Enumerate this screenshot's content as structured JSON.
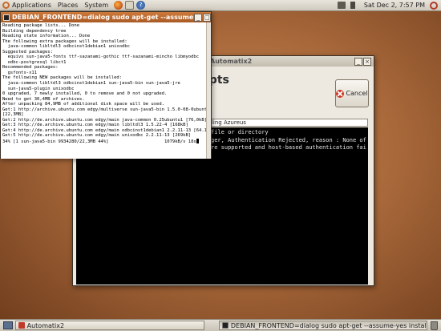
{
  "top_panel": {
    "menus": [
      "Applications",
      "Places",
      "System"
    ],
    "clock": "Sat Dec  2,  7:57 PM"
  },
  "automatix_window": {
    "title": "Automatix2",
    "heading": "ipts",
    "cancel_label": "Cancel",
    "status_field": "lling Azureus",
    "terminal_lines": [
      "file or directory",
      "ger, Authentication Rejected, reason : None of",
      "re supported and host-based authentication fai"
    ]
  },
  "terminal_window": {
    "title": "DEBIAN_FRONTEND=dialog sudo apt-get --assume",
    "lines": [
      "Reading package lists... Done",
      "Building dependency tree",
      "Reading state information... Done",
      "The following extra packages will be installed:",
      "  java-common libltdl3 odbcinst1debian1 unixodbc",
      "Suggested packages:",
      "  equivs sun-java5-fonts ttf-sazanami-gothic ttf-sazanami-mincho libmyodbc",
      "  odbc-postgresql libct1",
      "Recommended packages:",
      "  gsfonts-x11",
      "The following NEW packages will be installed:",
      "  java-common libltdl3 odbcinst1debian1 sun-java5-bin sun-java5-jre",
      "  sun-java5-plugin unixodbc",
      "0 upgraded, 7 newly installed, 0 to remove and 0 not upgraded.",
      "Need to get 30,4MB of archives.",
      "After unpacking 84,9MB of additional disk space will be used.",
      "Get:1 http://archive.ubuntu.com edgy/multiverse sun-java5-bin 1.5.0-08-0ubuntu1",
      "[22,3MB]",
      "Get:2 http://de.archive.ubuntu.com edgy/main java-common 0.25ubuntu1 [76,0kB]",
      "Get:3 http://de.archive.ubuntu.com edgy/main libltdl3 1.5.22-4 [168kB]",
      "Get:4 http://de.archive.ubuntu.com edgy/main odbcinst1debian1 2.2.11-13 [64.1kB]",
      "Get:5 http://de.archive.ubuntu.com edgy/main unixodbc 2.2.11-13 [269kB]",
      "34% [1 sun-java5-bin 9934280/22,3MB 44%]                     1079kB/s 18s"
    ]
  },
  "taskbar": {
    "tasks": [
      "Automatix2",
      "DEBIAN_FRONTEND=dialog sudo apt-get --assume-yes install s"
    ]
  }
}
